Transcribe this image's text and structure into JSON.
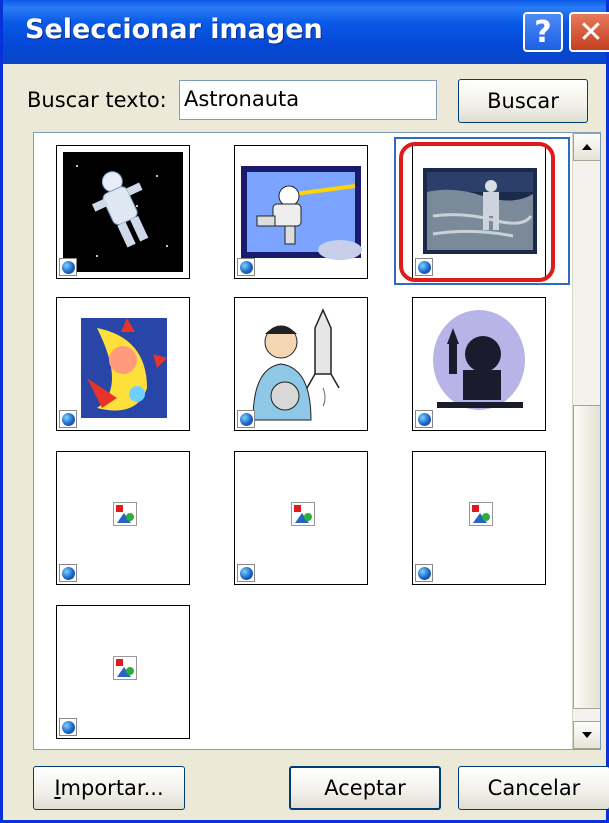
{
  "window": {
    "title": "Seleccionar imagen",
    "help": "?",
    "close": "✕"
  },
  "search": {
    "label": "Buscar texto:",
    "value": "Astronauta",
    "button": "Buscar"
  },
  "gallery": {
    "items": [
      {
        "name": "astronaut-space-black"
      },
      {
        "name": "astronaut-blue-frame"
      },
      {
        "name": "astronaut-moon-walk",
        "selected": true
      },
      {
        "name": "astronaut-cartoon-moon"
      },
      {
        "name": "astronaut-with-shuttle"
      },
      {
        "name": "astronaut-silhouette"
      },
      {
        "name": "placeholder-image"
      },
      {
        "name": "placeholder-image"
      },
      {
        "name": "placeholder-image"
      },
      {
        "name": "placeholder-image"
      }
    ]
  },
  "buttons": {
    "import": "Importar...",
    "import_underline": "I",
    "import_rest": "mportar...",
    "accept": "Aceptar",
    "cancel": "Cancelar"
  },
  "colors": {
    "titlebar": "#0a5ae8",
    "highlight": "#e01b1b",
    "selection": "#316ac5"
  }
}
